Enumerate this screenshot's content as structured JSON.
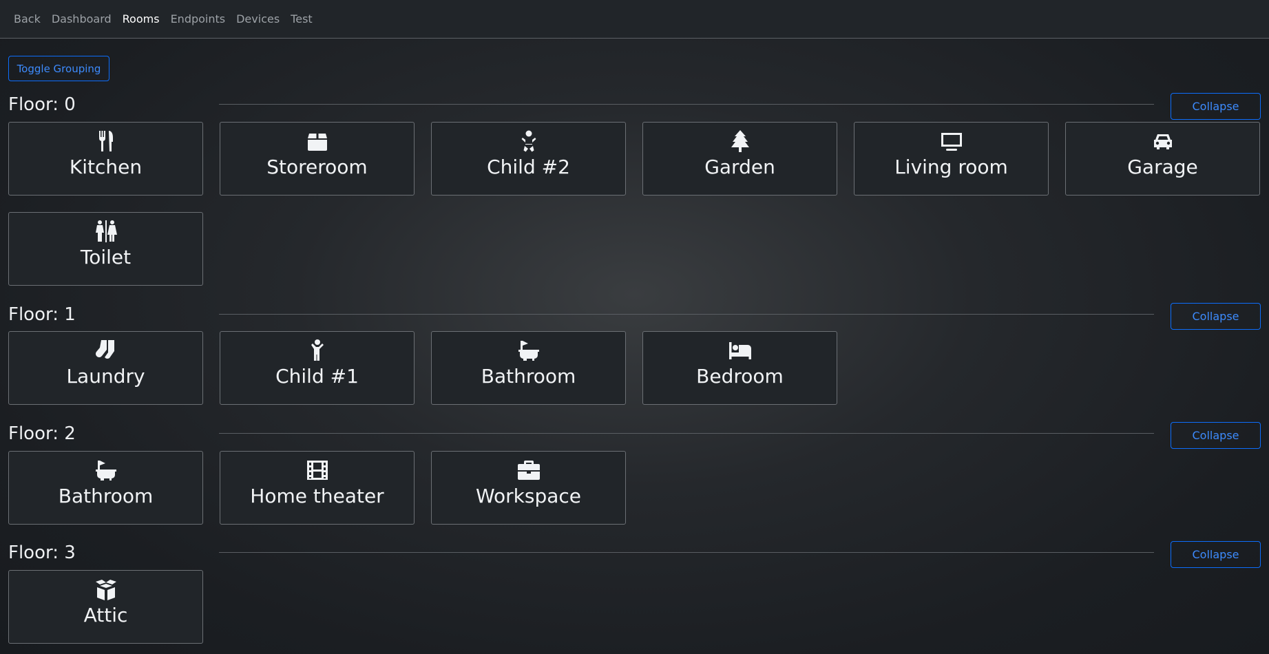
{
  "nav": {
    "items": [
      {
        "label": "Back",
        "active": false
      },
      {
        "label": "Dashboard",
        "active": false
      },
      {
        "label": "Rooms",
        "active": true
      },
      {
        "label": "Endpoints",
        "active": false
      },
      {
        "label": "Devices",
        "active": false
      },
      {
        "label": "Test",
        "active": false
      }
    ]
  },
  "toolbar": {
    "toggle_grouping_label": "Toggle Grouping"
  },
  "floors": [
    {
      "title": "Floor: 0",
      "collapse_label": "Collapse",
      "rooms": [
        {
          "label": "Kitchen",
          "icon": "utensils-icon"
        },
        {
          "label": "Storeroom",
          "icon": "box-icon"
        },
        {
          "label": "Child #2",
          "icon": "baby-icon"
        },
        {
          "label": "Garden",
          "icon": "tree-icon"
        },
        {
          "label": "Living room",
          "icon": "tv-icon"
        },
        {
          "label": "Garage",
          "icon": "car-icon"
        },
        {
          "label": "Toilet",
          "icon": "restroom-icon"
        }
      ]
    },
    {
      "title": "Floor: 1",
      "collapse_label": "Collapse",
      "rooms": [
        {
          "label": "Laundry",
          "icon": "socks-icon"
        },
        {
          "label": "Child #1",
          "icon": "child-icon"
        },
        {
          "label": "Bathroom",
          "icon": "bath-icon"
        },
        {
          "label": "Bedroom",
          "icon": "bed-icon"
        }
      ]
    },
    {
      "title": "Floor: 2",
      "collapse_label": "Collapse",
      "rooms": [
        {
          "label": "Bathroom",
          "icon": "bath-icon"
        },
        {
          "label": "Home theater",
          "icon": "film-icon"
        },
        {
          "label": "Workspace",
          "icon": "briefcase-icon"
        }
      ]
    },
    {
      "title": "Floor: 3",
      "collapse_label": "Collapse",
      "rooms": [
        {
          "label": "Attic",
          "icon": "box-open-icon"
        }
      ]
    }
  ],
  "colors": {
    "accent": "#0d6efd",
    "card_background": "#212529",
    "card_border": "#6c7075",
    "text": "#f1f3f5",
    "nav_inactive": "#9da2a7"
  }
}
